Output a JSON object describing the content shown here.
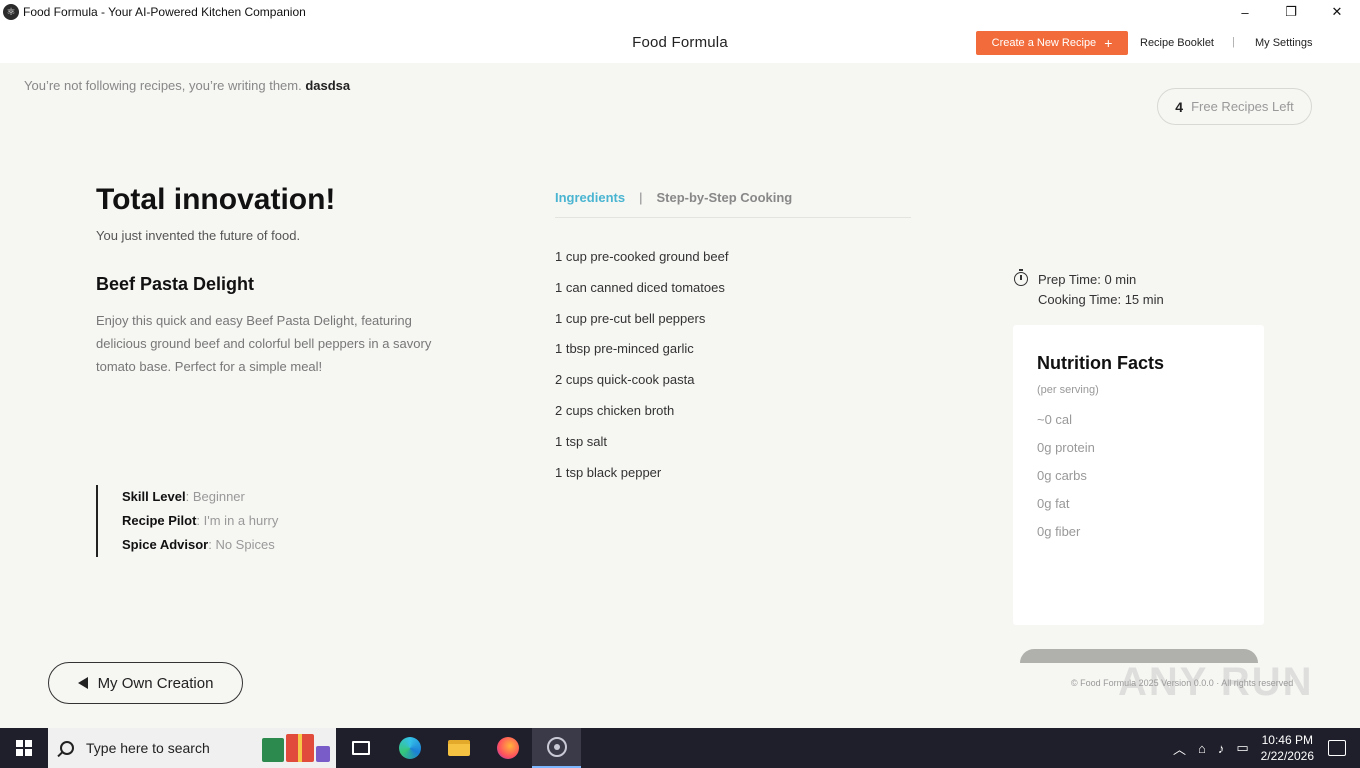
{
  "window": {
    "title": "Food Formula - Your AI-Powered Kitchen Companion",
    "minimize": "–",
    "maximize": "❐",
    "close": "✕"
  },
  "header": {
    "brand": "Food Formula",
    "create_label": "Create a New Recipe",
    "create_icon": "+",
    "nav": [
      "Recipe Booklet",
      "My Settings"
    ],
    "nav_separator": "|",
    "accent": "#f26b3a"
  },
  "tagline": {
    "text": "You’re not following recipes, you’re writing them.",
    "user": "dasdsa"
  },
  "free_recipes": {
    "count": "4",
    "label": "Free Recipes Left"
  },
  "result": {
    "headline": "Total innovation!",
    "subheadline": "You just invented the future of food.",
    "recipe_name": "Beef Pasta Delight",
    "description": "Enjoy this quick and easy Beef Pasta Delight, featuring delicious ground beef and colorful bell peppers in a savory tomato base. Perfect for a simple meal!"
  },
  "meta": [
    {
      "key": "Skill Level",
      "value": ": Beginner"
    },
    {
      "key": "Recipe Pilot",
      "value": ": I'm in a hurry"
    },
    {
      "key": "Spice Advisor",
      "value": ": No Spices"
    }
  ],
  "tabs": {
    "active": "Ingredients",
    "separator": "|",
    "inactive": "Step-by-Step Cooking",
    "active_color": "#4ab5d1"
  },
  "ingredients": [
    "1 cup pre-cooked ground beef",
    "1 can canned diced tomatoes",
    "1 cup pre-cut bell peppers",
    "1 tbsp pre-minced garlic",
    "2 cups quick-cook pasta",
    "2 cups chicken broth",
    "1 tsp salt",
    "1 tsp black pepper"
  ],
  "times": {
    "icon": "stopwatch-icon",
    "prep": "Prep Time: 0 min",
    "cooking": "Cooking Time: 15 min"
  },
  "nutrition": {
    "title": "Nutrition Facts",
    "subtitle": "(per serving)",
    "items": [
      "~0 cal",
      "0g protein",
      "0g carbs",
      "0g fat",
      "0g fiber"
    ]
  },
  "back_button": {
    "label": "My Own Creation",
    "icon": "left-triangle-icon"
  },
  "footer": {
    "text": "© Food Formula 2025 Version 0.0.0 · All rights reserved"
  },
  "taskbar": {
    "search_placeholder": "Type here to search",
    "tray": {
      "chevron": "︿",
      "time": "10:46 PM",
      "date": "2/22/2026"
    }
  },
  "watermark": "ANY RUN"
}
